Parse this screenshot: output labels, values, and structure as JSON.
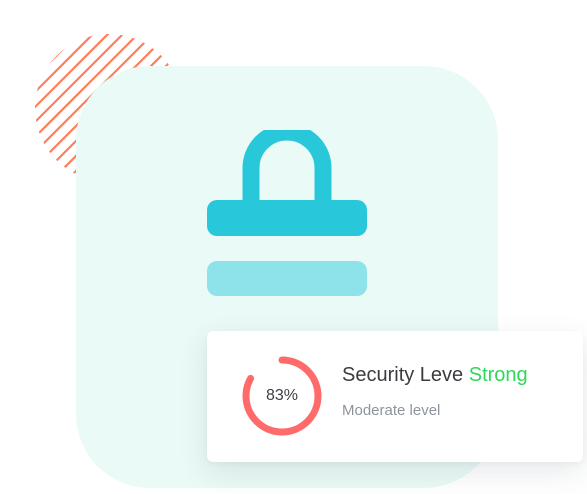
{
  "security_card": {
    "title": "Security Leve",
    "status": "Strong",
    "subtitle": "Moderate level",
    "progress_label": "83%",
    "progress_fraction": 0.83
  },
  "graphic": {
    "icon": "lock-icon"
  },
  "colors": {
    "mint_background": "#eafaf6",
    "lock_primary": "#28c7da",
    "lock_secondary": "#8ee3ea",
    "ring_progress": "#ff6b6b",
    "status_strong": "#2ed85b",
    "hatch_stripes": "#ff7d5a"
  }
}
